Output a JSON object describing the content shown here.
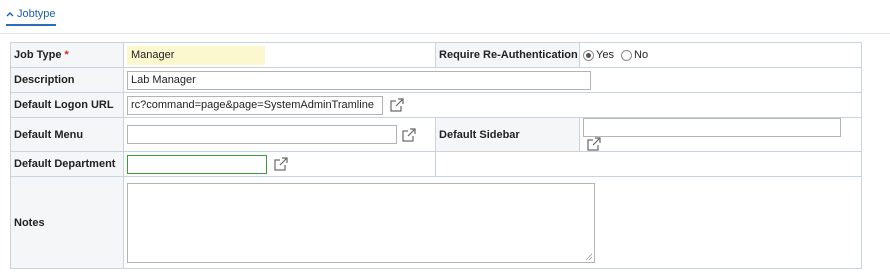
{
  "section": {
    "title": "Jobtype"
  },
  "fields": {
    "job_type": {
      "label": "Job Type",
      "required_mark": "*",
      "value": "Manager"
    },
    "reauth": {
      "label": "Require Re-Authentication",
      "yes_label": "Yes",
      "no_label": "No",
      "selected": "Yes"
    },
    "description": {
      "label": "Description",
      "value": "Lab Manager"
    },
    "logon_url": {
      "label": "Default Logon URL",
      "value": "rc?command=page&page=SystemAdminTramline"
    },
    "menu": {
      "label": "Default Menu",
      "value": ""
    },
    "sidebar": {
      "label": "Default Sidebar",
      "value": ""
    },
    "department": {
      "label": "Default Department",
      "value": ""
    },
    "notes": {
      "label": "Notes",
      "value": ""
    }
  },
  "colors": {
    "accent": "#2a6db5",
    "required": "#d9251d",
    "highlight_field": "#fbf8d0",
    "focus_border": "#3d9a3d"
  },
  "icons": {
    "collapse": "chevron-up-icon",
    "open_external": "external-link-icon"
  }
}
